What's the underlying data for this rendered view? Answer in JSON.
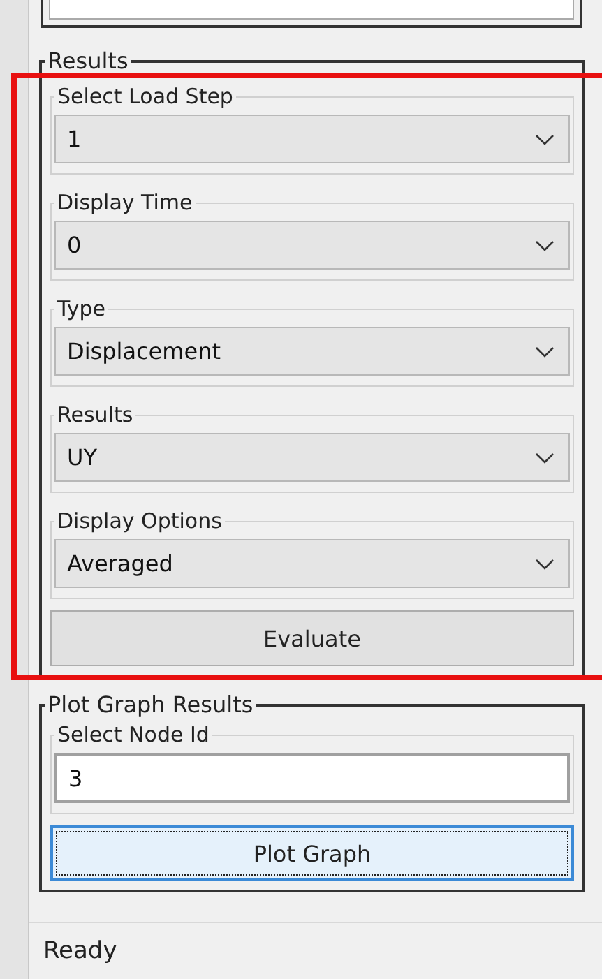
{
  "results": {
    "title": "Results",
    "fields": [
      {
        "label": "Select Load Step",
        "value": "1"
      },
      {
        "label": "Display Time",
        "value": "0"
      },
      {
        "label": "Type",
        "value": "Displacement"
      },
      {
        "label": "Results",
        "value": "UY"
      },
      {
        "label": "Display Options",
        "value": "Averaged"
      }
    ],
    "button": "Evaluate"
  },
  "plot": {
    "title": "Plot Graph Results",
    "field": {
      "label": "Select Node Id",
      "value": "3"
    },
    "button": {
      "label": "Plot Graph",
      "focused": true
    }
  },
  "status_bar": "Ready"
}
